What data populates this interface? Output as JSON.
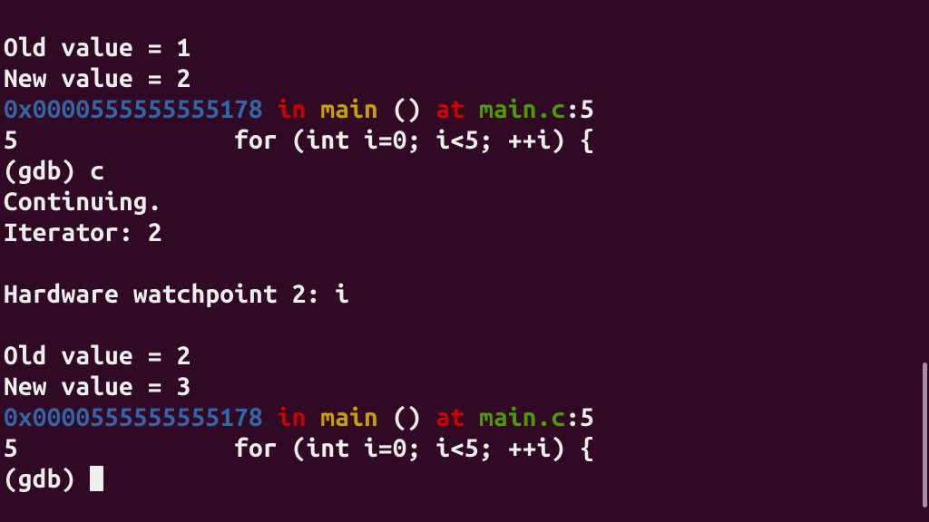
{
  "lines": {
    "l0": "Old value = 1",
    "l1": "New value = 2",
    "addr1": "0x0000555555555178",
    "in1": " in ",
    "func1": "main ",
    "parens1": "() ",
    "at1": "at ",
    "file1": "main.c",
    "colon1": ":",
    "lineno1": "5",
    "src_ln_a": "5",
    "src_pad_a": "               ",
    "src_code_a": "for (int i=0; i<5; ++i) {",
    "prompt1": "(gdb) ",
    "cmd1": "c",
    "cont": "Continuing.",
    "iter": "Iterator: 2",
    "blank": "",
    "watch": "Hardware watchpoint 2: i",
    "l2": "Old value = 2",
    "l3": "New value = 3",
    "addr2": "0x0000555555555178",
    "in2": " in ",
    "func2": "main ",
    "parens2": "() ",
    "at2": "at ",
    "file2": "main.c",
    "colon2": ":",
    "lineno2": "5",
    "src_ln_b": "5",
    "src_pad_b": "               ",
    "src_code_b": "for (int i=0; i<5; ++i) {",
    "prompt2": "(gdb) "
  }
}
